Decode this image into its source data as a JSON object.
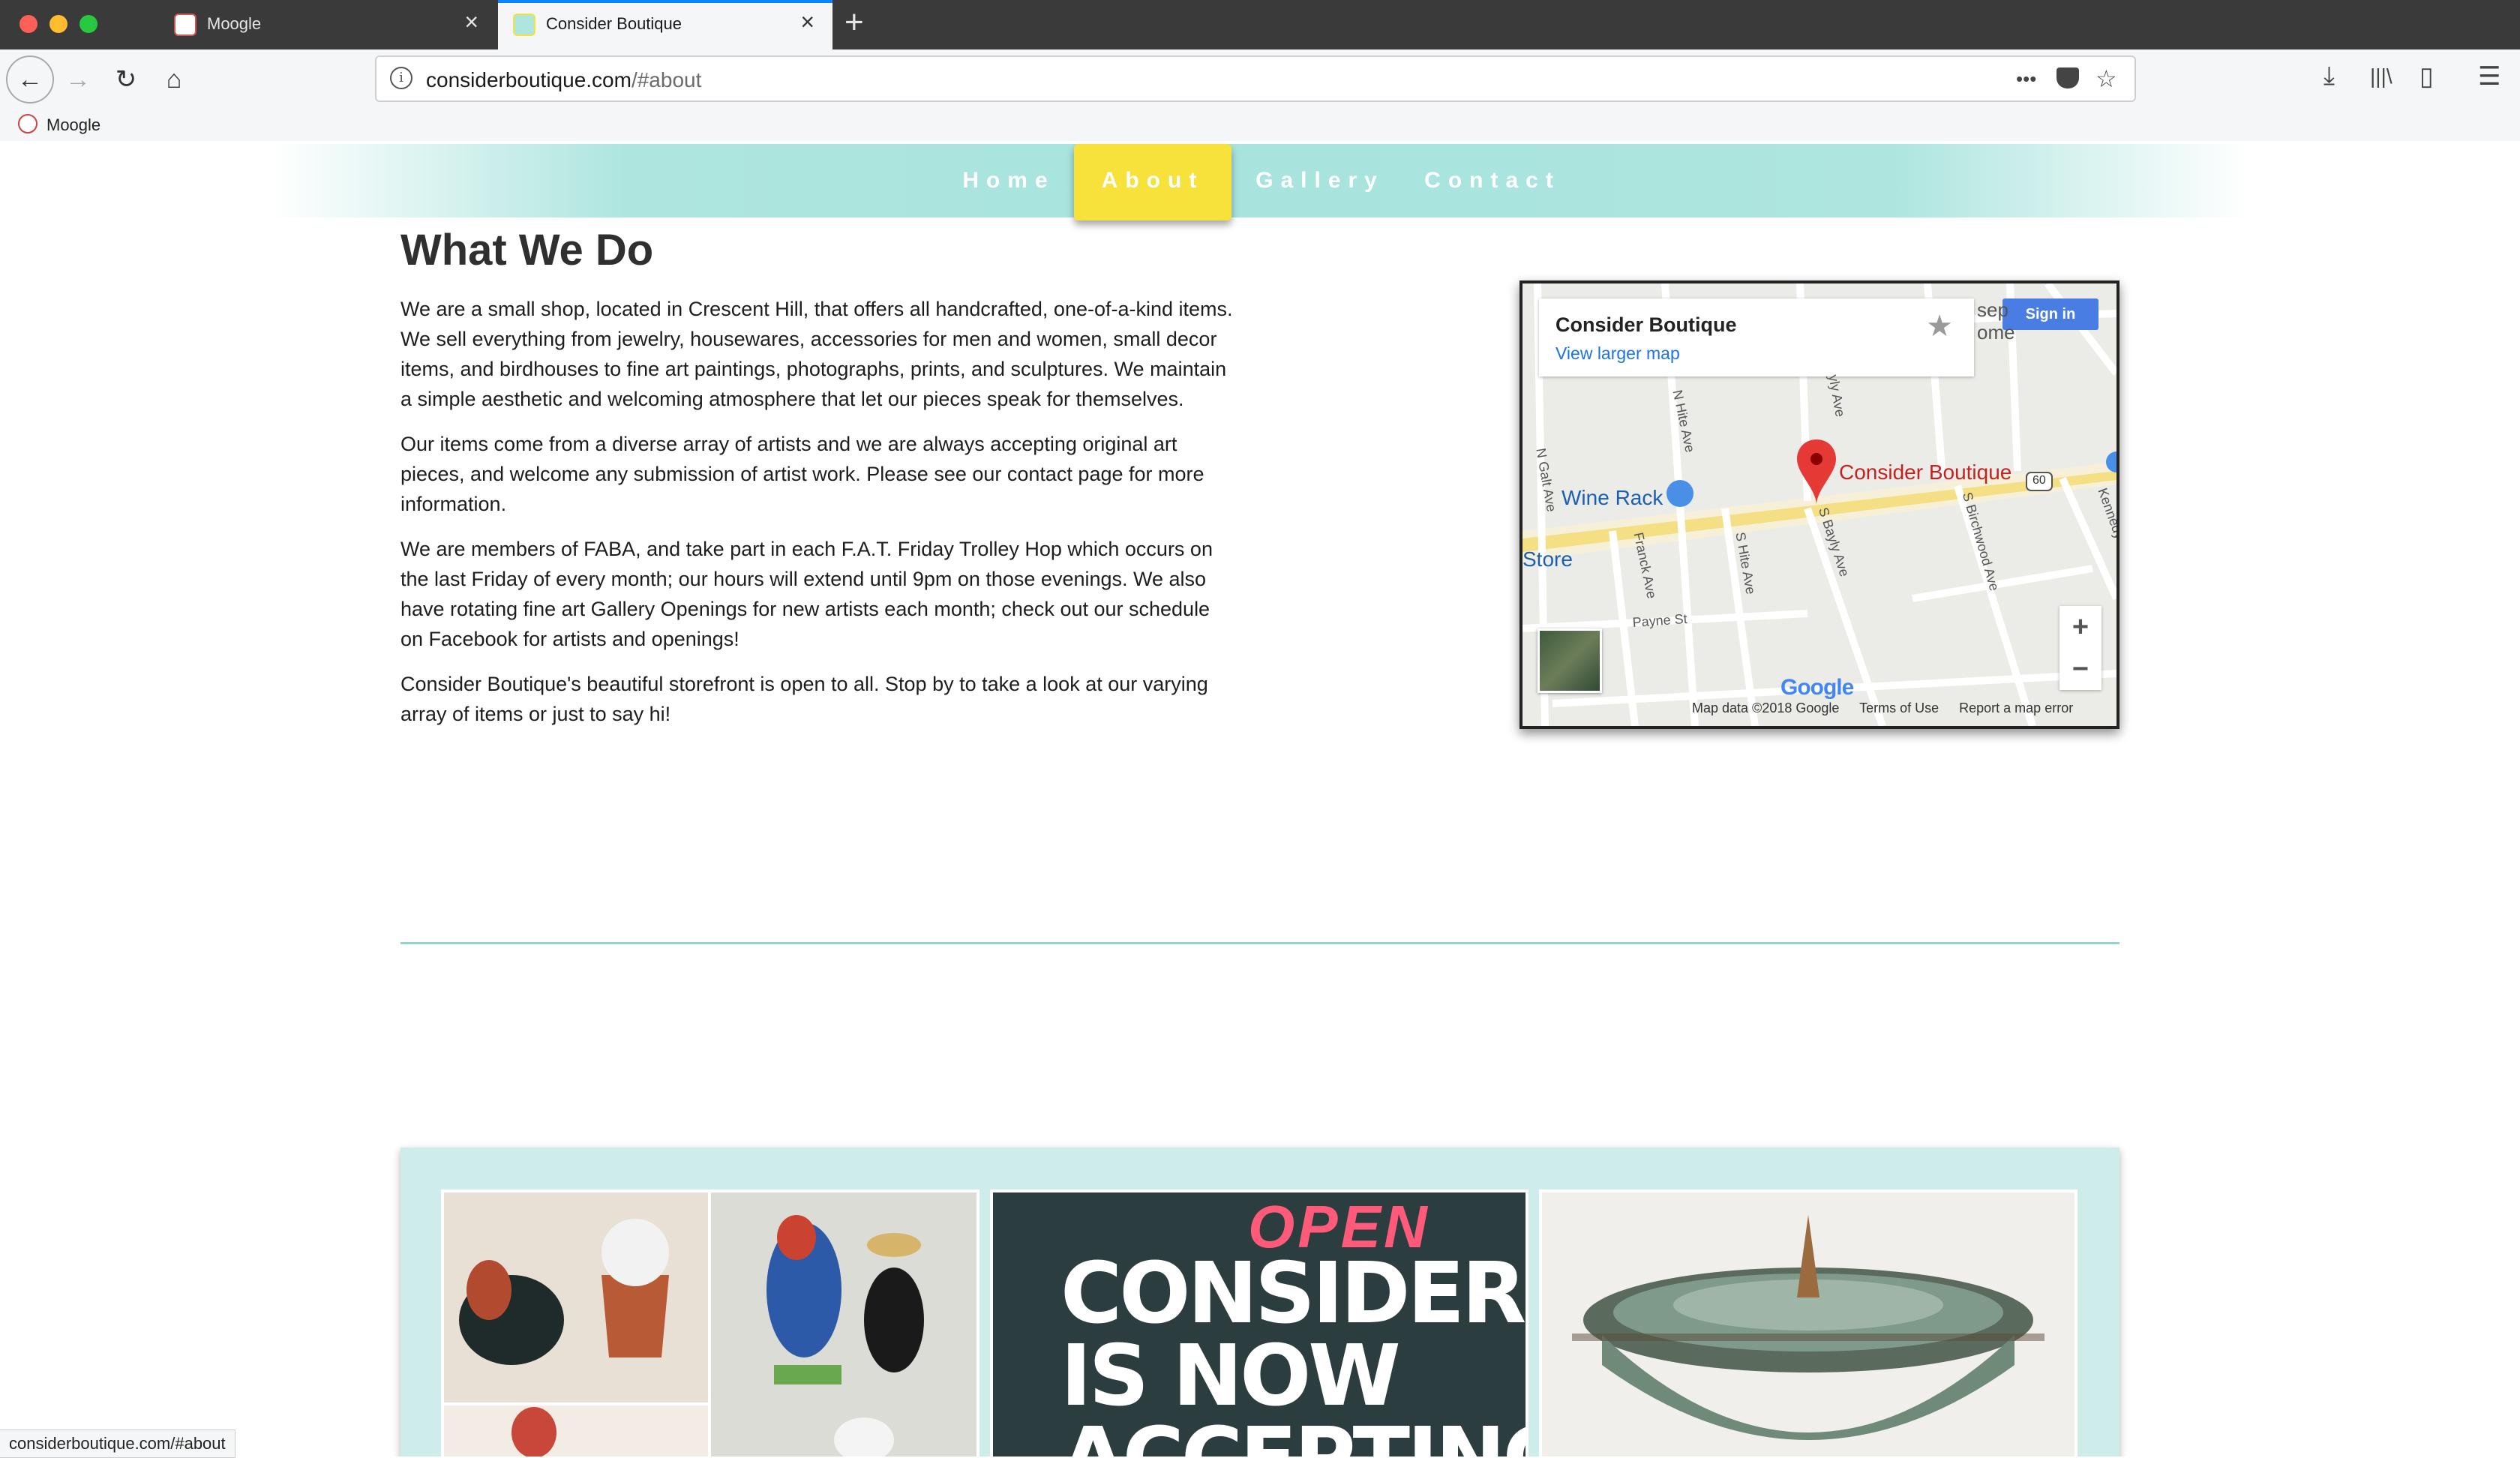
{
  "browser": {
    "tabs": [
      {
        "title": "Moogle",
        "active": false
      },
      {
        "title": "Consider Boutique",
        "active": true
      }
    ],
    "url_host": "considerboutique.com",
    "url_path": "/#about",
    "bookmarks": [
      {
        "label": "Moogle"
      }
    ],
    "status_text": "considerboutique.com/#about",
    "icons": {
      "back": "←",
      "forward": "→",
      "reload": "↻",
      "home": "⌂",
      "info": "i",
      "more": "•••",
      "pocket": "pocket-icon",
      "star": "☆",
      "downloads": "⤓",
      "library": "|||\\",
      "sidebar": "▯",
      "menu": "☰",
      "new_tab": "+",
      "close": "×"
    }
  },
  "site": {
    "nav": [
      {
        "label": "Home"
      },
      {
        "label": "About",
        "active": true
      },
      {
        "label": "Gallery"
      },
      {
        "label": "Contact"
      }
    ],
    "about": {
      "heading": "What We Do",
      "paragraphs": [
        "We are a small shop, located in Crescent Hill, that offers all handcrafted, one-of-a-kind items. We sell everything from jewelry, housewares, accessories for men and women, small decor items, and birdhouses to fine art paintings, photographs, prints, and sculptures. We maintain a simple aesthetic and welcoming atmosphere that let our pieces speak for themselves.",
        "Our items come from a diverse array of artists and we are always accepting original art pieces, and welcome any submission of artist work. Please see our contact page for more information.",
        "We are members of FABA, and take part in each F.A.T. Friday Trolley Hop which occurs on the last Friday of every month; our hours will extend until 9pm on those evenings. We also have rotating fine art Gallery Openings for new artists each month; check out our schedule on Facebook for artists and openings!",
        "Consider Boutique's beautiful storefront is open to all. Stop by to take a look at our varying array of items or just to say hi!"
      ]
    },
    "map": {
      "place_title": "Consider Boutique",
      "larger_map_link": "View larger map",
      "sign_in": "Sign in",
      "pin_label": "Consider Boutique",
      "poi_wine": "Wine Rack",
      "poi_store": "Store",
      "partial_label": "sep\nome",
      "route_shield": "60",
      "streets": [
        "N Galt Ave",
        "N Hite Ave",
        "Franck Ave",
        "S Hite Ave",
        "S Bayly Ave",
        "S Birchwood Ave",
        "Payne St",
        "Kennedy",
        "yly Ave"
      ],
      "zoom_in": "+",
      "zoom_out": "−",
      "google": "Google",
      "attribution": [
        "Map data ©2018 Google",
        "Terms of Use",
        "Report a map error"
      ]
    },
    "gallery": {
      "sign_text": [
        "CONSIDER",
        "IS NOW",
        "ACCEPTING"
      ],
      "sign_open": "OPEN"
    }
  },
  "colors": {
    "nav_teal": "#a8e3dd",
    "nav_active": "#f6e23a",
    "divider": "#8fd3cc",
    "gallery_bg": "#cdecea",
    "map_pin": "#e53935",
    "link_blue": "#1a73e8"
  }
}
